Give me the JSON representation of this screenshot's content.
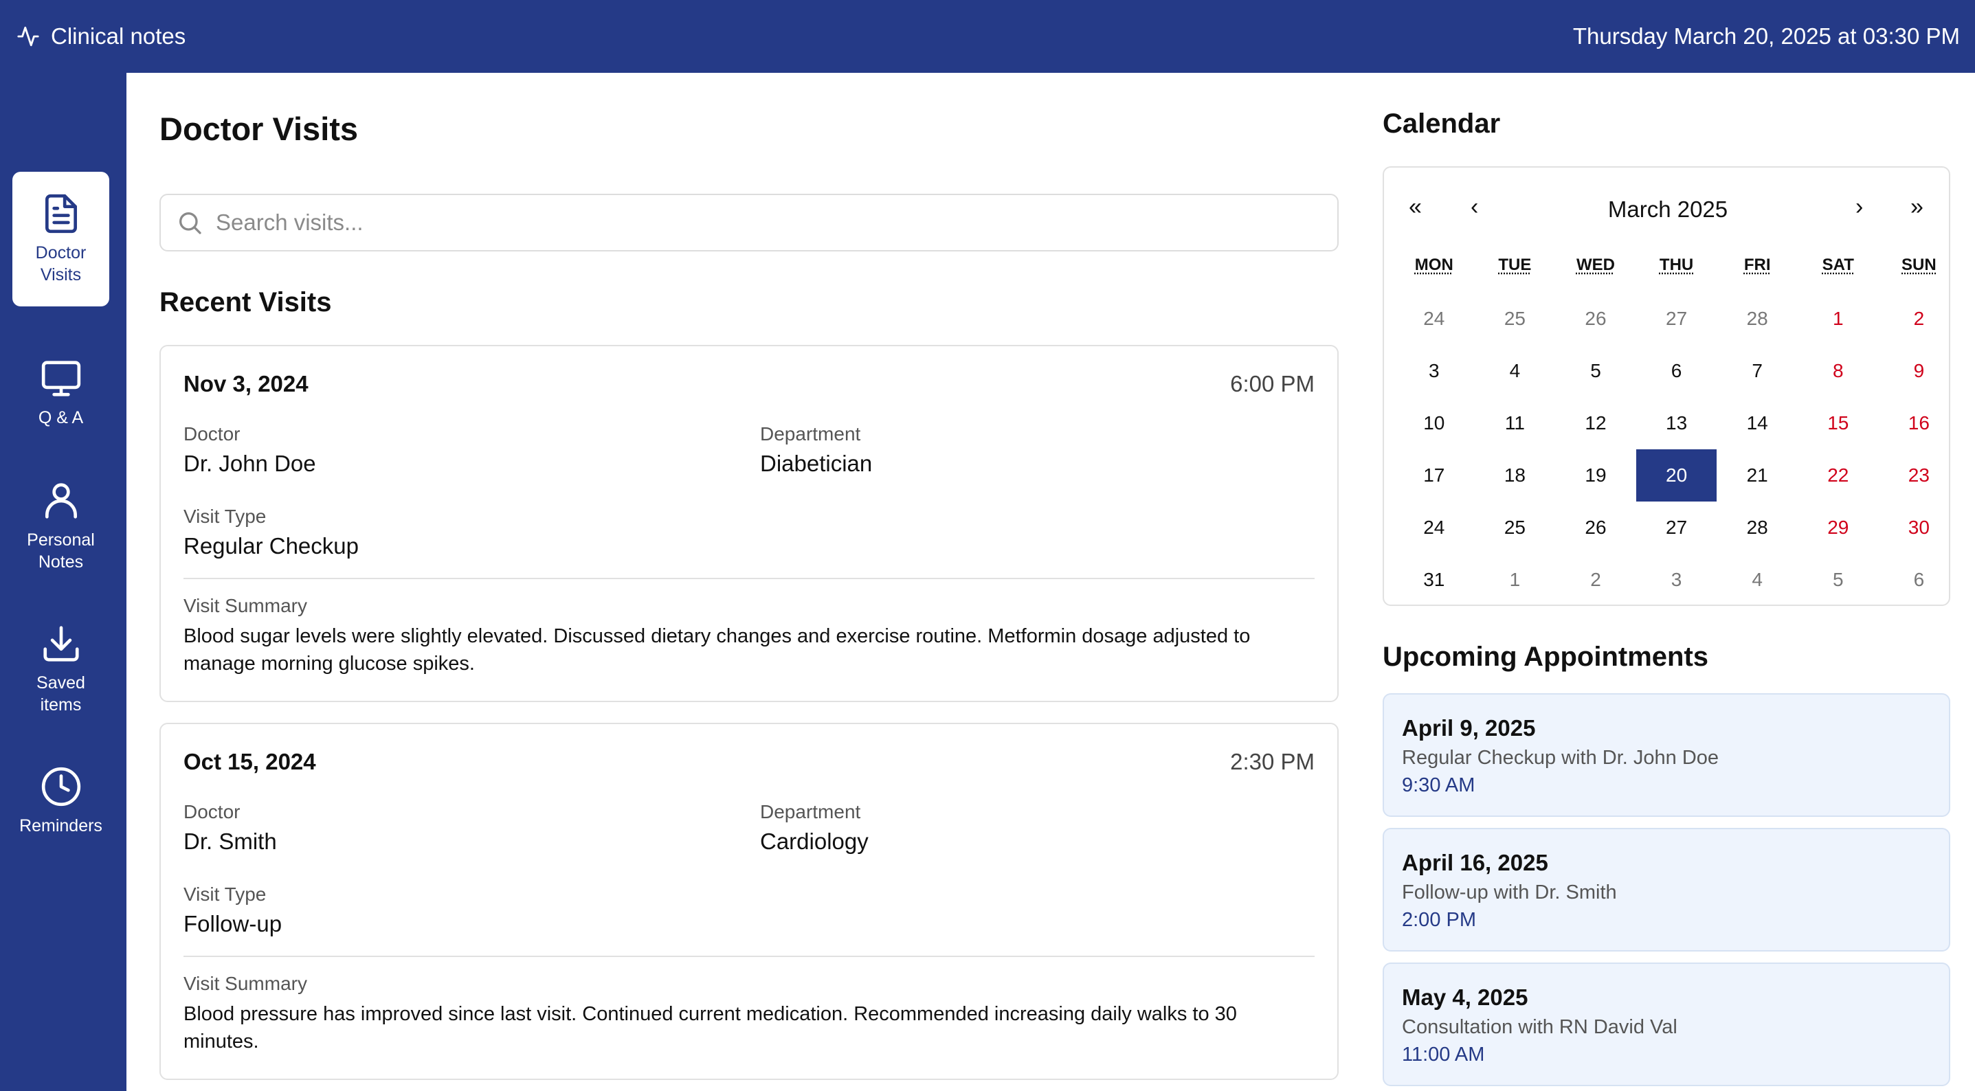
{
  "app": {
    "title": "Clinical notes",
    "datetime": "Thursday March 20, 2025 at 03:30 PM"
  },
  "sidebar": {
    "items": [
      {
        "label": "Doctor\nVisits",
        "icon": "document-icon",
        "active": true
      },
      {
        "label": "Q & A",
        "icon": "monitor-icon",
        "active": false
      },
      {
        "label": "Personal\nNotes",
        "icon": "person-icon",
        "active": false
      },
      {
        "label": "Saved\nitems",
        "icon": "download-icon",
        "active": false
      },
      {
        "label": "Reminders",
        "icon": "clock-icon",
        "active": false
      }
    ]
  },
  "main": {
    "title": "Doctor Visits",
    "search_placeholder": "Search visits...",
    "recent_title": "Recent Visits",
    "field_labels": {
      "doctor": "Doctor",
      "department": "Department",
      "visit_type": "Visit Type",
      "summary": "Visit Summary"
    },
    "visits": [
      {
        "date": "Nov 3, 2024",
        "time": "6:00 PM",
        "doctor": "Dr. John Doe",
        "department": "Diabetician",
        "visit_type": "Regular Checkup",
        "summary": "Blood sugar levels were slightly elevated. Discussed dietary changes and exercise routine. Metformin dosage adjusted to manage morning glucose spikes."
      },
      {
        "date": "Oct 15, 2024",
        "time": "2:30 PM",
        "doctor": "Dr. Smith",
        "department": "Cardiology",
        "visit_type": "Follow-up",
        "summary": "Blood pressure has improved since last visit. Continued current medication. Recommended increasing daily walks to 30 minutes."
      }
    ]
  },
  "calendar": {
    "title": "Calendar",
    "month_label": "March 2025",
    "nav": {
      "prev_year": "«",
      "prev_month": "‹",
      "next_month": "›",
      "next_year": "»"
    },
    "weekdays": [
      "MON",
      "TUE",
      "WED",
      "THU",
      "FRI",
      "SAT",
      "SUN"
    ],
    "weeks": [
      [
        "24",
        "25",
        "26",
        "27",
        "28",
        "1",
        "2"
      ],
      [
        "3",
        "4",
        "5",
        "6",
        "7",
        "8",
        "9"
      ],
      [
        "10",
        "11",
        "12",
        "13",
        "14",
        "15",
        "16"
      ],
      [
        "17",
        "18",
        "19",
        "20",
        "21",
        "22",
        "23"
      ],
      [
        "24",
        "25",
        "26",
        "27",
        "28",
        "29",
        "30"
      ],
      [
        "31",
        "1",
        "2",
        "3",
        "4",
        "5",
        "6"
      ]
    ],
    "other_month": [
      [
        true,
        true,
        true,
        true,
        true,
        false,
        false
      ],
      [
        false,
        false,
        false,
        false,
        false,
        false,
        false
      ],
      [
        false,
        false,
        false,
        false,
        false,
        false,
        false
      ],
      [
        false,
        false,
        false,
        false,
        false,
        false,
        false
      ],
      [
        false,
        false,
        false,
        false,
        false,
        false,
        false
      ],
      [
        false,
        true,
        true,
        true,
        true,
        true,
        true
      ]
    ],
    "selected_day": "20",
    "accent_color": "#253a87",
    "weekend_color": "#d0021b"
  },
  "appointments": {
    "title": "Upcoming Appointments",
    "items": [
      {
        "date": "April 9, 2025",
        "description": "Regular Checkup with Dr. John Doe",
        "time": "9:30 AM"
      },
      {
        "date": "April 16, 2025",
        "description": "Follow-up with Dr. Smith",
        "time": "2:00 PM"
      },
      {
        "date": "May 4, 2025",
        "description": "Consultation with RN David Val",
        "time": "11:00 AM"
      }
    ]
  }
}
